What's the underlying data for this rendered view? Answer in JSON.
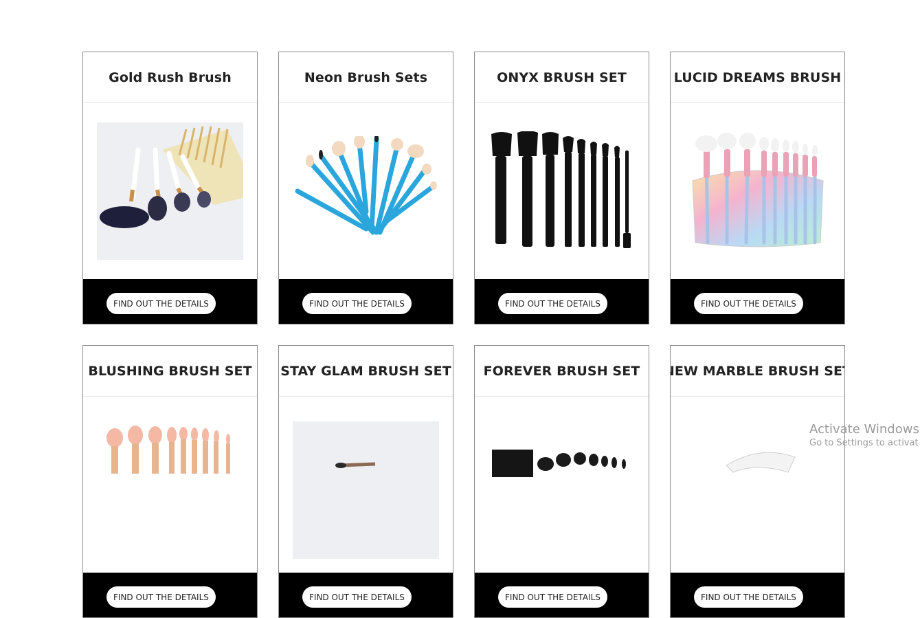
{
  "products": [
    {
      "title": "Gold Rush Brush",
      "button": "FIND OUT THE DETAILS",
      "image": "gold-rush-brush-image",
      "accent": "#c8914a"
    },
    {
      "title": "Neon Brush Sets",
      "button": "FIND OUT THE DETAILS",
      "image": "neon-brush-set-image",
      "accent": "#2aa6dc"
    },
    {
      "title": "ONYX BRUSH SET",
      "button": "FIND OUT THE DETAILS",
      "image": "onyx-brush-set-image",
      "accent": "#111111"
    },
    {
      "title": "LUCID DREAMS BRUSH",
      "button": "FIND OUT THE DETAILS",
      "image": "lucid-dreams-brush-image",
      "accent": "#e9a2b6"
    },
    {
      "title": "BLUSHING BRUSH SET",
      "button": "FIND OUT THE DETAILS",
      "image": "blushing-brush-set-image",
      "accent": "#f2b8a8"
    },
    {
      "title": "STAY GLAM BRUSH SET",
      "button": "FIND OUT THE DETAILS",
      "image": "stay-glam-brush-set-image",
      "accent": "#8a6a55"
    },
    {
      "title": "FOREVER BRUSH SET",
      "button": "FIND OUT THE DETAILS",
      "image": "forever-brush-set-image",
      "accent": "#1a1a1a"
    },
    {
      "title": "NEW MARBLE BRUSH SET",
      "button": "FIND OUT THE DETAILS",
      "image": "new-marble-brush-set-image",
      "accent": "#cfcfcf"
    }
  ],
  "watermark": {
    "line1": "Activate Windows",
    "line2": "Go to Settings to activat"
  }
}
